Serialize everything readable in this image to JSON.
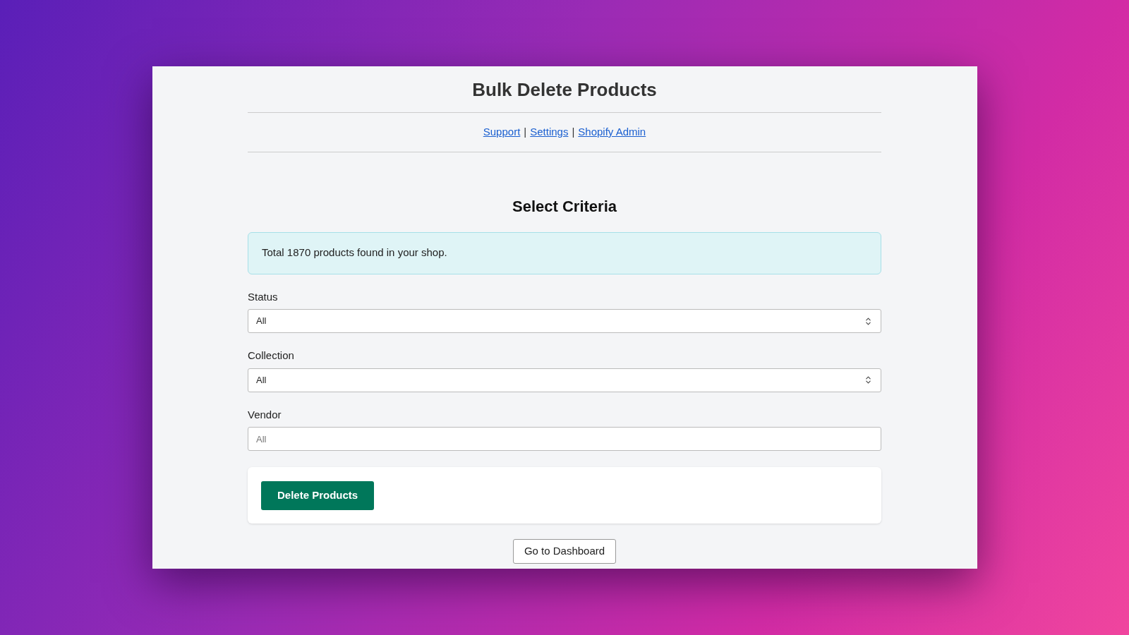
{
  "title": "Bulk Delete Products",
  "links": [
    "Support",
    "Settings",
    "Shopify Admin"
  ],
  "separator": "|",
  "section_title": "Select Criteria",
  "notice": "Total 1870 products found in your shop.",
  "fields": [
    {
      "kind": "select",
      "label": "Status",
      "value": "All"
    },
    {
      "kind": "select",
      "label": "Collection",
      "value": "All"
    },
    {
      "kind": "text",
      "label": "Vendor",
      "placeholder": "All"
    }
  ],
  "primary_button": "Delete Products",
  "secondary_button": "Go to Dashboard"
}
